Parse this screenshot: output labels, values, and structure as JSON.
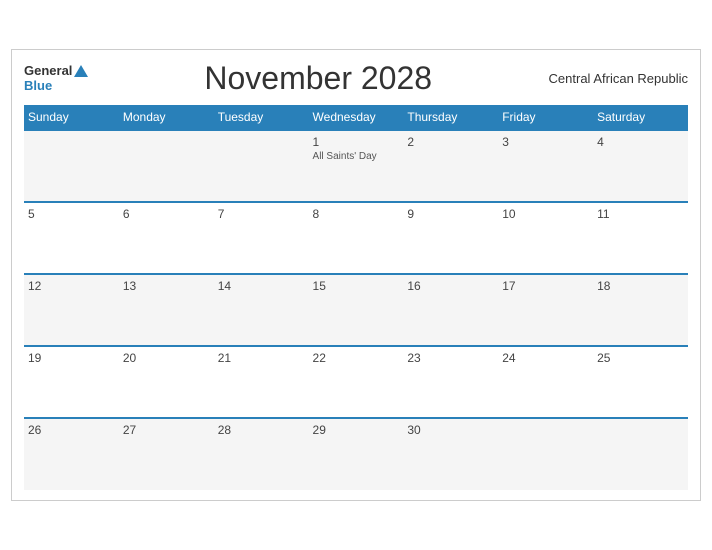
{
  "header": {
    "logo_general": "General",
    "logo_blue": "Blue",
    "title": "November 2028",
    "country": "Central African Republic"
  },
  "weekdays": [
    "Sunday",
    "Monday",
    "Tuesday",
    "Wednesday",
    "Thursday",
    "Friday",
    "Saturday"
  ],
  "weeks": [
    [
      {
        "day": "",
        "event": ""
      },
      {
        "day": "",
        "event": ""
      },
      {
        "day": "",
        "event": ""
      },
      {
        "day": "1",
        "event": "All Saints' Day"
      },
      {
        "day": "2",
        "event": ""
      },
      {
        "day": "3",
        "event": ""
      },
      {
        "day": "4",
        "event": ""
      }
    ],
    [
      {
        "day": "5",
        "event": ""
      },
      {
        "day": "6",
        "event": ""
      },
      {
        "day": "7",
        "event": ""
      },
      {
        "day": "8",
        "event": ""
      },
      {
        "day": "9",
        "event": ""
      },
      {
        "day": "10",
        "event": ""
      },
      {
        "day": "11",
        "event": ""
      }
    ],
    [
      {
        "day": "12",
        "event": ""
      },
      {
        "day": "13",
        "event": ""
      },
      {
        "day": "14",
        "event": ""
      },
      {
        "day": "15",
        "event": ""
      },
      {
        "day": "16",
        "event": ""
      },
      {
        "day": "17",
        "event": ""
      },
      {
        "day": "18",
        "event": ""
      }
    ],
    [
      {
        "day": "19",
        "event": ""
      },
      {
        "day": "20",
        "event": ""
      },
      {
        "day": "21",
        "event": ""
      },
      {
        "day": "22",
        "event": ""
      },
      {
        "day": "23",
        "event": ""
      },
      {
        "day": "24",
        "event": ""
      },
      {
        "day": "25",
        "event": ""
      }
    ],
    [
      {
        "day": "26",
        "event": ""
      },
      {
        "day": "27",
        "event": ""
      },
      {
        "day": "28",
        "event": ""
      },
      {
        "day": "29",
        "event": ""
      },
      {
        "day": "30",
        "event": ""
      },
      {
        "day": "",
        "event": ""
      },
      {
        "day": "",
        "event": ""
      }
    ]
  ]
}
